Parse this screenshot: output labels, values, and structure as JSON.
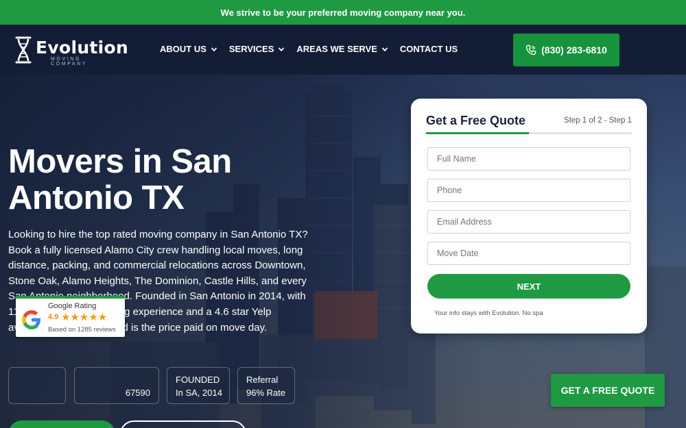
{
  "announcement": "We strive to be your preferred moving company near you.",
  "brand": {
    "name": "Evolution",
    "subtitle": "MOVING COMPANY"
  },
  "nav": [
    {
      "label": "ABOUT US",
      "has_dropdown": true
    },
    {
      "label": "SERVICES",
      "has_dropdown": true
    },
    {
      "label": "AREAS WE SERVE",
      "has_dropdown": true
    },
    {
      "label": "CONTACT US",
      "has_dropdown": false
    }
  ],
  "phone": {
    "label": "(830) 283-6810",
    "icon": "phone-icon"
  },
  "hero": {
    "title": "Movers in San Antonio TX",
    "description": "Looking to hire the top rated moving company in San Antonio TX? Book a fully licensed Alamo City crew handling local moves, long distance, packing, and commercial relocations across Downtown, Stone Oak, Alamo Heights, The Dominion, Castle Hills, and every San Antonio neighborhood. Founded in San Antonio in 2014, with 11+ years of Texas moving experience and a 4.6 star Yelp average. The price quoted is the price paid on move day."
  },
  "stats": [
    {
      "line1": "",
      "line2": "67590"
    },
    {
      "line1": "FOUNDED",
      "line2": "In SA, 2014"
    },
    {
      "line1": "Referral",
      "line2": "96% Rate"
    }
  ],
  "google_rating": {
    "title": "Google Rating",
    "score": "4.9",
    "stars": 5,
    "reviews": "Based on 1285 reviews"
  },
  "quote_form": {
    "title": "Get a Free Quote",
    "step": "Step 1 of 2 - Step 1",
    "progress": 0.5,
    "fields": [
      {
        "placeholder": "Full Name"
      },
      {
        "placeholder": "Phone"
      },
      {
        "placeholder": "Email Address"
      },
      {
        "placeholder": "Move Date"
      }
    ],
    "submit": "NEXT",
    "footer": "Your info stays with Evolution. No spa"
  },
  "floating_cta": "GET A FREE QUOTE",
  "colors": {
    "brand_green": "#1f9a43",
    "header_navy": "#141d36",
    "star_orange": "#f39c12"
  }
}
